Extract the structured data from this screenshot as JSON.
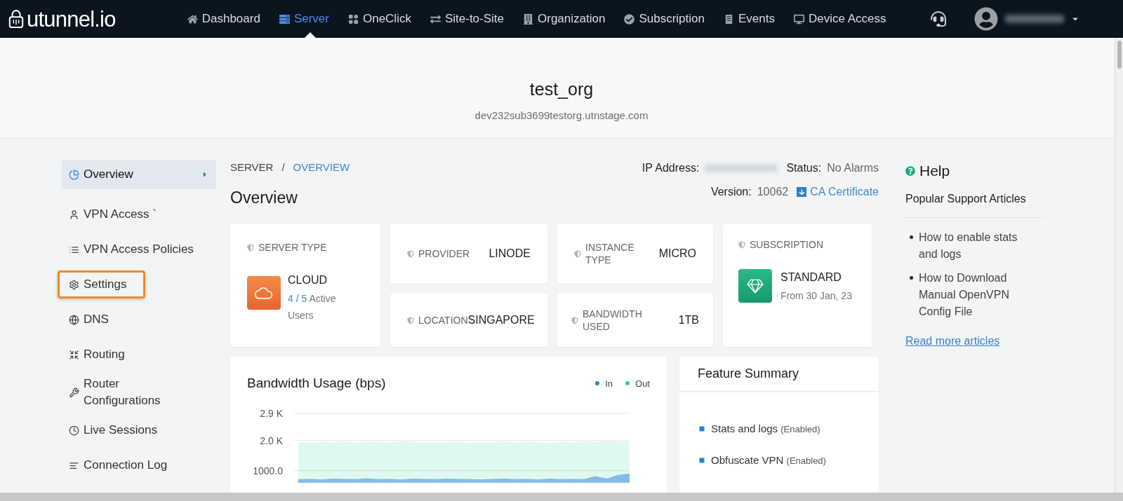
{
  "brand": {
    "name": "utunnel.io"
  },
  "nav": [
    {
      "label": "Dashboard",
      "selected": false
    },
    {
      "label": "Server",
      "selected": true
    },
    {
      "label": "OneClick",
      "selected": false
    },
    {
      "label": "Site-to-Site",
      "selected": false
    },
    {
      "label": "Organization",
      "selected": false
    },
    {
      "label": "Subscription",
      "selected": false
    },
    {
      "label": "Events",
      "selected": false
    },
    {
      "label": "Device Access",
      "selected": false
    }
  ],
  "org": {
    "name": "test_org",
    "domain": "dev232sub3699testorg.utnstage.com"
  },
  "sidebar": {
    "items": [
      {
        "label": "Overview",
        "selected": true,
        "highlighted": false
      },
      {
        "label": "VPN Access `",
        "selected": false,
        "highlighted": false
      },
      {
        "label": "VPN Access Policies",
        "selected": false,
        "highlighted": false
      },
      {
        "label": "Settings",
        "selected": false,
        "highlighted": true
      },
      {
        "label": "DNS",
        "selected": false,
        "highlighted": false
      },
      {
        "label": "Routing",
        "selected": false,
        "highlighted": false
      },
      {
        "label": "Router Configurations",
        "selected": false,
        "highlighted": false
      },
      {
        "label": "Live Sessions",
        "selected": false,
        "highlighted": false
      },
      {
        "label": "Connection Log",
        "selected": false,
        "highlighted": false
      }
    ]
  },
  "breadcrumb": [
    "SERVER",
    "/",
    "OVERVIEW"
  ],
  "page_title": "Overview",
  "server_info": {
    "ip_label": "IP Address:",
    "status_label": "Status:",
    "status": "No Alarms",
    "version_label": "Version:",
    "version": "10062",
    "certificate_link": "CA Certificate"
  },
  "cards": {
    "server_type": {
      "label": "SERVER TYPE",
      "value": "CLOUD",
      "users_count": "4 / 5",
      "users_text": "Active Users"
    },
    "provider": {
      "label": "PROVIDER",
      "value": "LINODE"
    },
    "instance_type": {
      "label": "INSTANCE TYPE",
      "value": "MICRO"
    },
    "location": {
      "label": "LOCATION",
      "value": "SINGAPORE"
    },
    "bandwidth_used": {
      "label": "BANDWIDTH USED",
      "value": "1TB"
    },
    "subscription": {
      "label": "SUBSCRIPTION",
      "value": "STANDARD",
      "since": "From 30 Jan, 23"
    }
  },
  "bandwidth": {
    "title": "Bandwidth Usage (bps)",
    "chart_data": {
      "type": "area",
      "ylim": [
        600,
        2900
      ],
      "grid": true,
      "yticks": [
        {
          "value": 1000,
          "label": "1000.0"
        },
        {
          "value": 2000,
          "label": "2.0 K"
        },
        {
          "value": 2900,
          "label": "2.9 K"
        }
      ],
      "series": [
        {
          "name": "In",
          "color": "#2b7fd4",
          "values": [
            720,
            730,
            710,
            740,
            730,
            720,
            750,
            720,
            730,
            710,
            740,
            730,
            720,
            740,
            730,
            720,
            710,
            730,
            740,
            720,
            730,
            710,
            740,
            720,
            730,
            720,
            820,
            740,
            860,
            900
          ]
        },
        {
          "name": "Out",
          "color": "#2ed49c",
          "values": [
            1950,
            1930,
            1960,
            1940,
            1970,
            1920,
            1960,
            1950,
            1940,
            1970,
            1960,
            1930,
            1950,
            1940,
            1960,
            1910,
            1950,
            1940,
            1970,
            1930,
            1960,
            1950,
            1920,
            1960,
            1940,
            1970,
            1950,
            1990,
            1960,
            1970
          ]
        }
      ]
    }
  },
  "feature_summary": {
    "title": "Feature Summary",
    "items": [
      {
        "name": "Stats and logs",
        "status": "(Enabled)"
      },
      {
        "name": "Obfuscate VPN",
        "status": "(Enabled)"
      }
    ]
  },
  "help": {
    "title": "Help",
    "subtitle": "Popular Support Articles",
    "articles": [
      "How to enable stats and logs",
      "How to Download Manual OpenVPN Config File"
    ],
    "more_link": "Read more articles"
  }
}
